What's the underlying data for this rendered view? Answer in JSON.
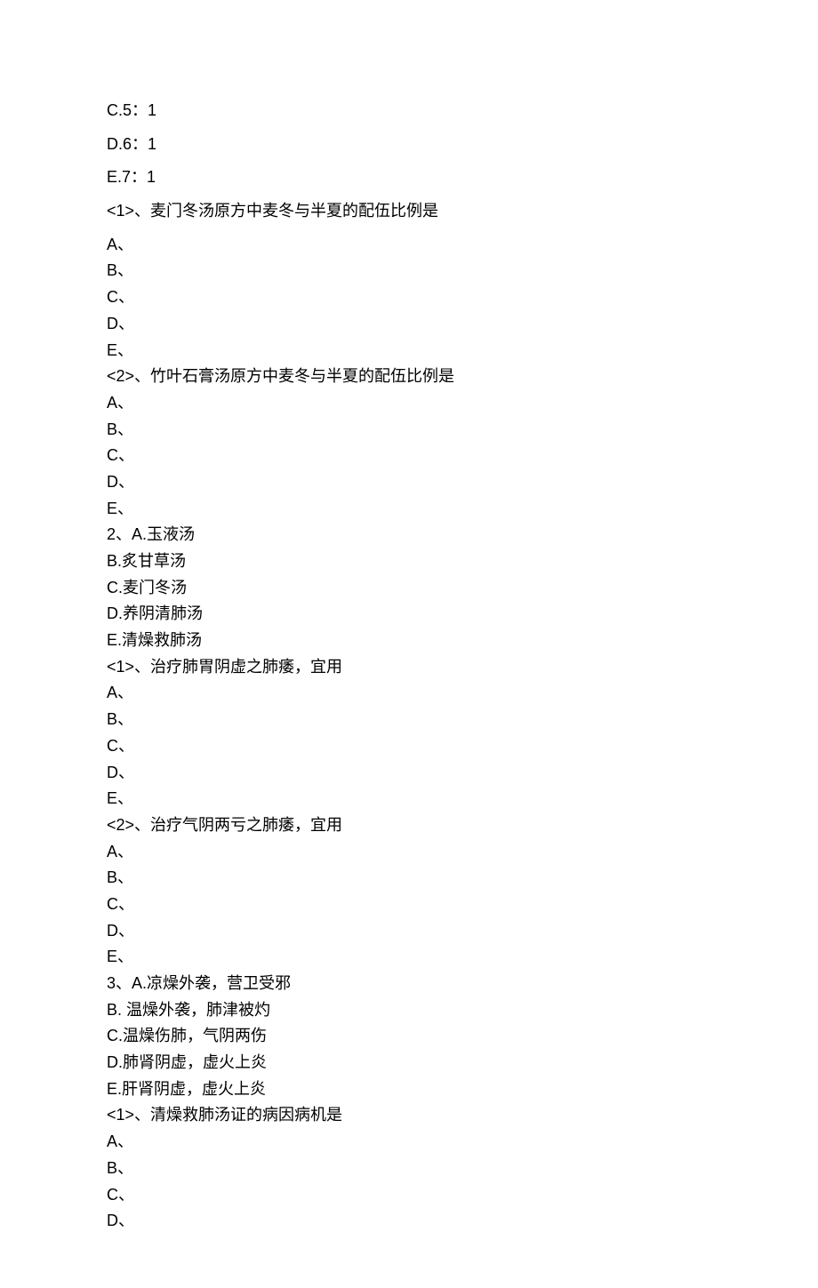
{
  "lines": [
    {
      "text": "C.5：1",
      "spaced": true
    },
    {
      "text": "D.6：1",
      "spaced": true
    },
    {
      "text": "E.7：1",
      "spaced": true
    },
    {
      "text": "<1>、麦门冬汤原方中麦冬与半夏的配伍比例是",
      "spaced": true
    },
    {
      "text": "A、",
      "spaced": false
    },
    {
      "text": "B、",
      "spaced": false
    },
    {
      "text": "C、",
      "spaced": false
    },
    {
      "text": "D、",
      "spaced": false
    },
    {
      "text": "E、",
      "spaced": false
    },
    {
      "text": "<2>、竹叶石膏汤原方中麦冬与半夏的配伍比例是",
      "spaced": false
    },
    {
      "text": "A、",
      "spaced": false
    },
    {
      "text": "B、",
      "spaced": false
    },
    {
      "text": "C、",
      "spaced": false
    },
    {
      "text": "D、",
      "spaced": false
    },
    {
      "text": "E、",
      "spaced": false
    },
    {
      "text": "2、A.玉液汤",
      "spaced": false
    },
    {
      "text": "B.炙甘草汤",
      "spaced": false
    },
    {
      "text": "C.麦门冬汤",
      "spaced": false
    },
    {
      "text": "D.养阴清肺汤",
      "spaced": false
    },
    {
      "text": "E.清燥救肺汤",
      "spaced": false
    },
    {
      "text": "<1>、治疗肺胃阴虚之肺痿，宜用",
      "spaced": false
    },
    {
      "text": "A、",
      "spaced": false
    },
    {
      "text": "B、",
      "spaced": false
    },
    {
      "text": "C、",
      "spaced": false
    },
    {
      "text": "D、",
      "spaced": false
    },
    {
      "text": "E、",
      "spaced": false
    },
    {
      "text": "<2>、治疗气阴两亏之肺痿，宜用",
      "spaced": false
    },
    {
      "text": "A、",
      "spaced": false
    },
    {
      "text": "B、",
      "spaced": false
    },
    {
      "text": "C、",
      "spaced": false
    },
    {
      "text": "D、",
      "spaced": false
    },
    {
      "text": "E、",
      "spaced": false
    },
    {
      "text": "3、A.凉燥外袭，营卫受邪",
      "spaced": false
    },
    {
      "text": "B. 温燥外袭，肺津被灼",
      "spaced": false
    },
    {
      "text": "C.温燥伤肺，气阴两伤",
      "spaced": false
    },
    {
      "text": "D.肺肾阴虚，虚火上炎",
      "spaced": false
    },
    {
      "text": "E.肝肾阴虚，虚火上炎",
      "spaced": false
    },
    {
      "text": "<1>、清燥救肺汤证的病因病机是",
      "spaced": false
    },
    {
      "text": "A、",
      "spaced": false
    },
    {
      "text": "B、",
      "spaced": false
    },
    {
      "text": "C、",
      "spaced": false
    },
    {
      "text": "D、",
      "spaced": false
    }
  ]
}
